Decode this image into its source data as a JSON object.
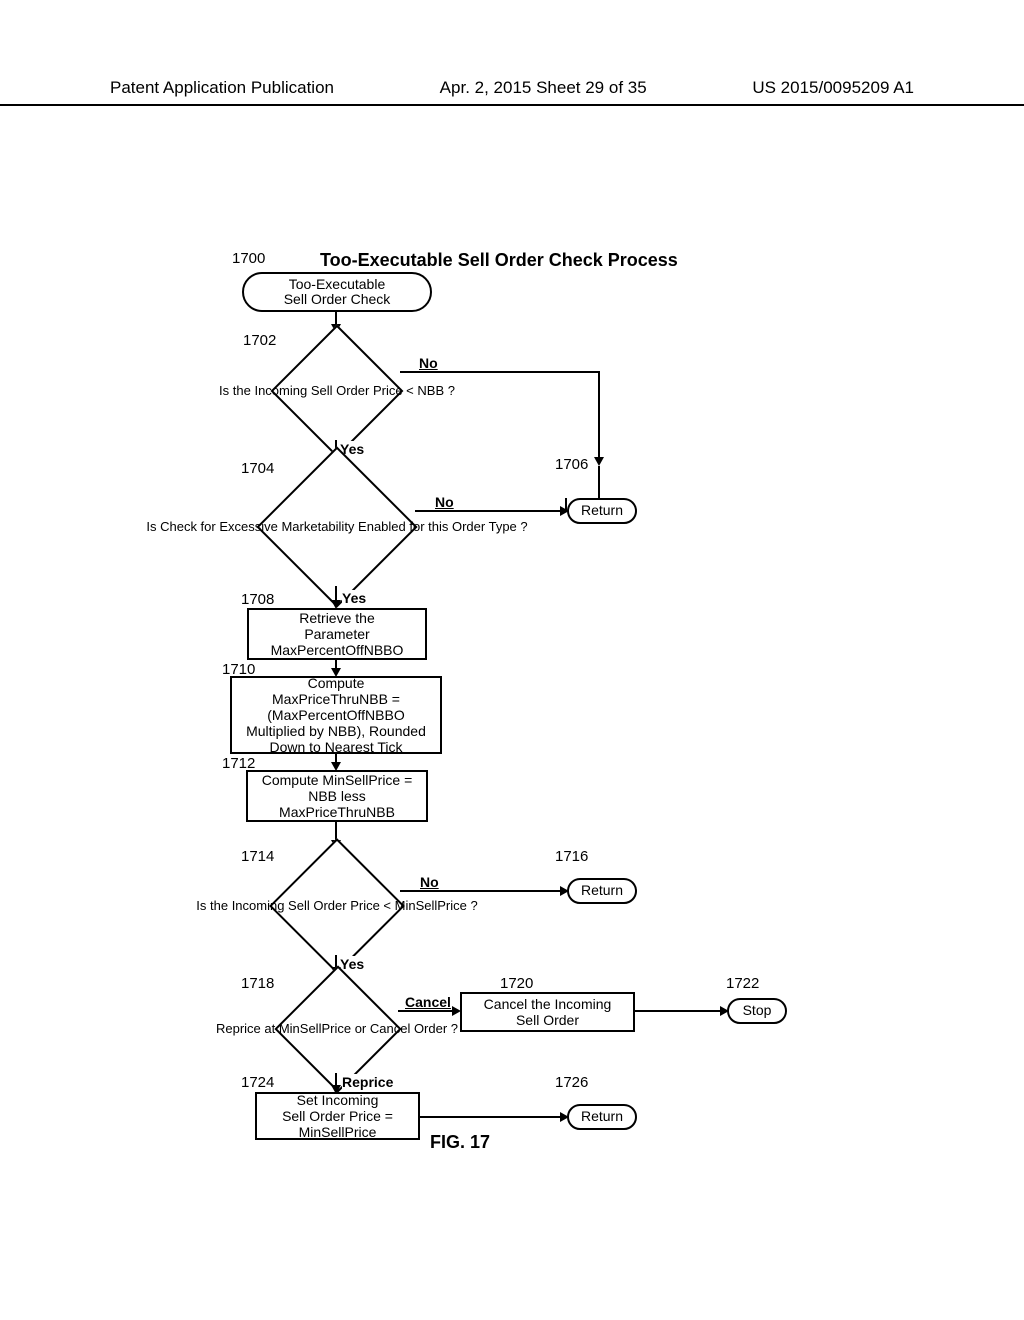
{
  "header": {
    "left": "Patent Application Publication",
    "mid": "Apr. 2, 2015  Sheet 29 of 35",
    "right": "US 2015/0095209 A1"
  },
  "title": "Too-Executable Sell Order Check Process",
  "figure_label": "FIG. 17",
  "refs": {
    "r1700": "1700",
    "r1702": "1702",
    "r1704": "1704",
    "r1706": "1706",
    "r1708": "1708",
    "r1710": "1710",
    "r1712": "1712",
    "r1714": "1714",
    "r1716": "1716",
    "r1718": "1718",
    "r1720": "1720",
    "r1722": "1722",
    "r1724": "1724",
    "r1726": "1726"
  },
  "nodes": {
    "n1700": "Too-Executable\nSell Order Check",
    "n1702": "Is\nthe Incoming\nSell Order Price\n< NBB\n?",
    "n1704": "Is\nCheck for\nExcessive Marketability\nEnabled for this Order\nType\n?",
    "n1706": "Return",
    "n1708": "Retrieve the\nParameter\nMaxPercentOffNBBO",
    "n1710": "Compute\nMaxPriceThruNBB =\n(MaxPercentOffNBBO\nMultiplied by NBB), Rounded\nDown to Nearest Tick",
    "n1712": "Compute MinSellPrice =\nNBB less\nMaxPriceThruNBB",
    "n1714": "Is\nthe Incoming\nSell Order Price <\nMinSellPrice\n?",
    "n1716": "Return",
    "n1718": "Reprice\nat MinSellPrice\nor Cancel Order\n?",
    "n1720": "Cancel the Incoming\nSell Order",
    "n1722": "Stop",
    "n1724": "Set Incoming\nSell Order Price =\nMinSellPrice",
    "n1726": "Return"
  },
  "edge_labels": {
    "no": "No",
    "yes": "Yes",
    "cancel": "Cancel",
    "reprice": "Reprice"
  }
}
